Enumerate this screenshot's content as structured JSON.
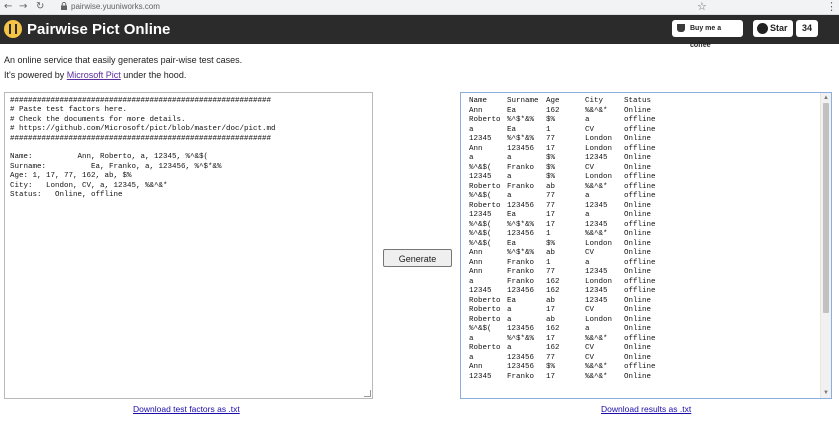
{
  "browser": {
    "url": "pairwise.yuuniworks.com"
  },
  "header": {
    "title": "Pairwise Pict Online",
    "coffee_label": "Buy me a coffee",
    "github_label": "Star",
    "github_count": "34"
  },
  "intro": {
    "line1": "An online service that easily generates pair-wise test cases.",
    "line2_prefix": "It's powered by ",
    "line2_link": "Microsoft Pict",
    "line2_suffix": "  under the hood."
  },
  "input": {
    "text": "##########################################################\n# Paste test factors here.\n# Check the documents for more details.\n# https://github.com/Microsoft/pict/blob/master/doc/pict.md\n##########################################################\n\nName:          Ann, Roberto, a, 12345, %^&$(\nSurname:          Ea, Franko, a, 123456, %^$*&%\nAge: 1, 17, 77, 162, ab, $%\nCity:   London, CV, a, 12345, %&^&*\nStatus:   Online, offline"
  },
  "generate_label": "Generate",
  "results": {
    "headers": [
      "Name",
      "Surname",
      "Age",
      "City",
      "Status"
    ],
    "rows": [
      [
        "Ann",
        "Ea",
        "162",
        "%&^&*",
        "Online"
      ],
      [
        "Roberto",
        "%^$*&%",
        "$%",
        "a",
        "offline"
      ],
      [
        "a",
        "Ea",
        "1",
        "CV",
        "offline"
      ],
      [
        "12345",
        "%^$*&%",
        "77",
        "London",
        "Online"
      ],
      [
        "Ann",
        "123456",
        "17",
        "London",
        "offline"
      ],
      [
        "a",
        "a",
        "$%",
        "12345",
        "Online"
      ],
      [
        "%^&$(",
        "Franko",
        "$%",
        "CV",
        "Online"
      ],
      [
        "12345",
        "a",
        "$%",
        "London",
        "offline"
      ],
      [
        "Roberto",
        "Franko",
        "ab",
        "%&^&*",
        "offline"
      ],
      [
        "%^&$(",
        "a",
        "77",
        "a",
        "offline"
      ],
      [
        "Roberto",
        "123456",
        "77",
        "12345",
        "Online"
      ],
      [
        "12345",
        "Ea",
        "17",
        "a",
        "Online"
      ],
      [
        "%^&$(",
        "%^$*&%",
        "17",
        "12345",
        "offline"
      ],
      [
        "%^&$(",
        "123456",
        "1",
        "%&^&*",
        "Online"
      ],
      [
        "%^&$(",
        "Ea",
        "$%",
        "London",
        "Online"
      ],
      [
        "Ann",
        "%^$*&%",
        "ab",
        "CV",
        "Online"
      ],
      [
        "Ann",
        "Franko",
        "1",
        "a",
        "offline"
      ],
      [
        "Ann",
        "Franko",
        "77",
        "12345",
        "Online"
      ],
      [
        "a",
        "Franko",
        "162",
        "London",
        "offline"
      ],
      [
        "12345",
        "123456",
        "162",
        "12345",
        "offline"
      ],
      [
        "Roberto",
        "Ea",
        "ab",
        "12345",
        "Online"
      ],
      [
        "Roberto",
        "a",
        "17",
        "CV",
        "Online"
      ],
      [
        "Roberto",
        "a",
        "ab",
        "London",
        "Online"
      ],
      [
        "%^&$(",
        "123456",
        "162",
        "a",
        "Online"
      ],
      [
        "a",
        "%^$*&%",
        "17",
        "%&^&*",
        "offline"
      ],
      [
        "Roberto",
        "a",
        "162",
        "CV",
        "Online"
      ],
      [
        "a",
        "123456",
        "77",
        "CV",
        "Online"
      ],
      [
        "Ann",
        "123456",
        "$%",
        "%&^&*",
        "offline"
      ],
      [
        "12345",
        "Franko",
        "17",
        "%&^&*",
        "Online"
      ]
    ]
  },
  "downloads": {
    "factors": "Download test factors as .txt",
    "results": "Download results as .txt"
  }
}
